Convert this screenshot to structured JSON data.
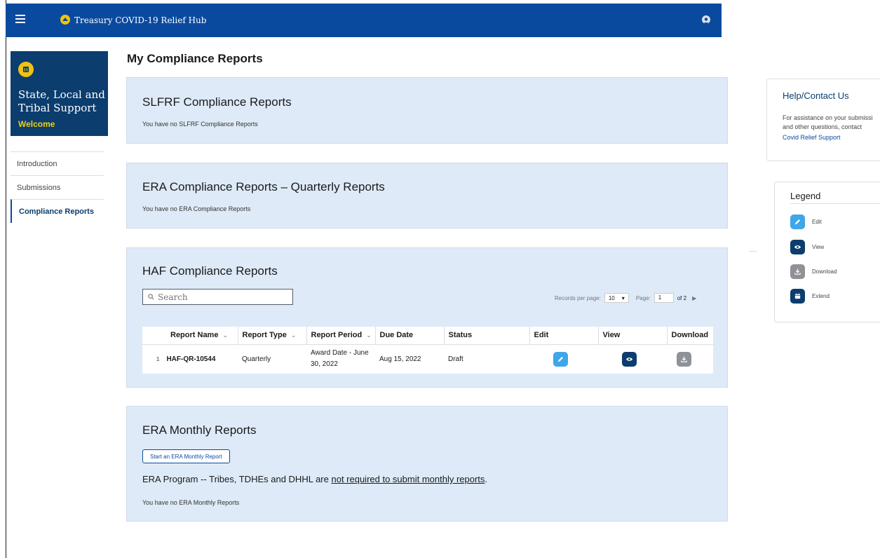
{
  "header": {
    "app_title": "Treasury COVID-19 Relief Hub",
    "menu_icon": "hamburger-icon",
    "logo_icon": "treasury-seal-icon",
    "account_icon": "user-avatar-icon"
  },
  "sidebar": {
    "agency_title": "State, Local and Tribal Support",
    "welcome": "Welcome",
    "items": [
      {
        "label": "Introduction"
      },
      {
        "label": "Submissions"
      },
      {
        "label": "Compliance Reports",
        "active": true
      }
    ]
  },
  "main": {
    "page_title": "My Compliance Reports",
    "slfrf": {
      "title": "SLFRF Compliance Reports",
      "note": "You have no SLFRF Compliance Reports"
    },
    "era_quarterly": {
      "title": "ERA Compliance Reports – Quarterly Reports",
      "note": "You have no ERA Compliance Reports"
    },
    "haf": {
      "title": "HAF Compliance Reports",
      "search_placeholder": "Search",
      "records_per_page_label": "Records per page:",
      "records_per_page": "10",
      "page_label": "Page:",
      "page": "1",
      "of_pages": "of 2",
      "columns": [
        "Report Name",
        "Report Type",
        "Report Period",
        "Due Date",
        "Status",
        "Edit",
        "View",
        "Download"
      ],
      "rows": [
        {
          "num": "1",
          "report_name": "HAF-QR-10544",
          "report_type": "Quarterly",
          "report_period": "Award Date - June 30, 2022",
          "due_date": "Aug 15, 2022",
          "status": "Draft"
        }
      ]
    },
    "era_monthly": {
      "title": "ERA Monthly Reports",
      "start_button": "Start an ERA Monthly Report",
      "program_prefix": "ERA Program -- Tribes, TDHEs and DHHL are ",
      "program_link": "not required to submit monthly reports",
      "program_suffix": ".",
      "note": "You have no ERA Monthly Reports"
    }
  },
  "help": {
    "title": "Help/Contact Us",
    "text_line1": "For assistance on your submissi",
    "text_line2": "and other questions, contact",
    "link": "Covid Relief Support"
  },
  "legend": {
    "title": "Legend",
    "items": [
      {
        "label": "Edit",
        "icon": "pencil-icon"
      },
      {
        "label": "View",
        "icon": "eye-icon"
      },
      {
        "label": "Download",
        "icon": "download-icon"
      },
      {
        "label": "Extend",
        "icon": "calendar-icon"
      }
    ]
  },
  "colors": {
    "header_blue": "#0a4a9e",
    "panel_bg": "#deeaf8",
    "sidebar_card": "#0b3d6e",
    "edit_blue": "#3fa6e9",
    "draft_red": "#d63e04",
    "download_gray": "#8e9196"
  }
}
